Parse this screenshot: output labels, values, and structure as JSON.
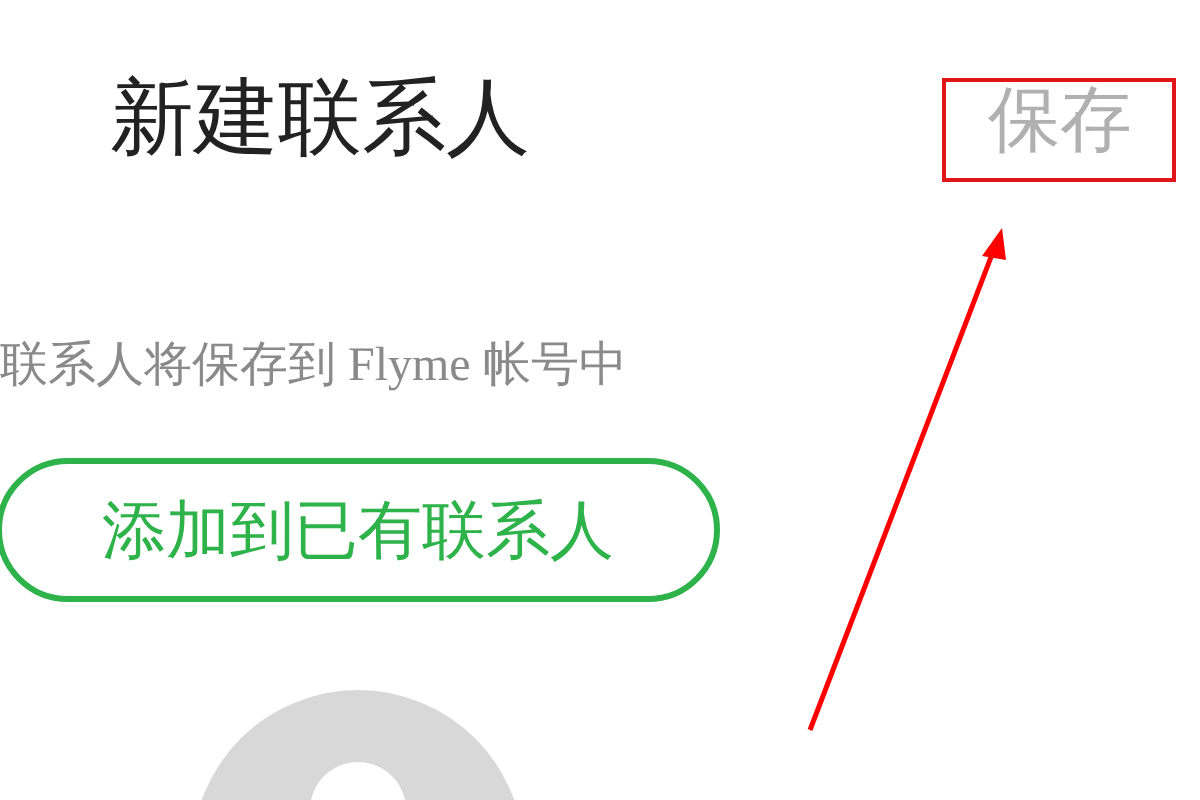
{
  "header": {
    "title": "新建联系人",
    "save_button": "保存"
  },
  "notice": "联系人将保存到 Flyme 帐号中",
  "add_existing_button": "添加到已有联系人"
}
